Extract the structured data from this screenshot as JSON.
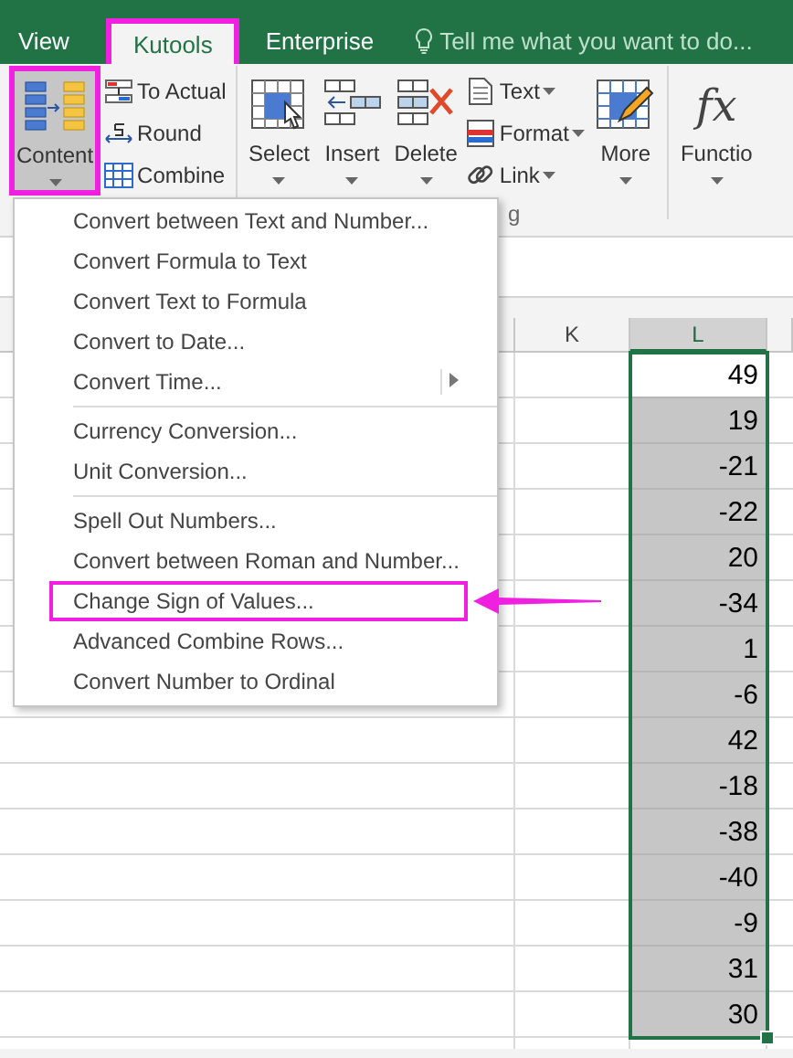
{
  "tabs": [
    {
      "label": "View",
      "selected": false
    },
    {
      "label": "Kutools",
      "selected": true
    },
    {
      "label": "Enterprise",
      "selected": false
    }
  ],
  "tell_me": {
    "placeholder": "Tell me what you want to do..."
  },
  "ribbon": {
    "controls": [
      {
        "kind": "large",
        "label": "Content",
        "highlighted": true
      },
      {
        "kind": "stack",
        "items": [
          {
            "label": "To Actual",
            "dropdown": false
          },
          {
            "label": "Round",
            "dropdown": false
          },
          {
            "label": "Combine",
            "dropdown": false
          }
        ]
      },
      {
        "kind": "separator"
      },
      {
        "kind": "large",
        "label": "Select",
        "highlighted": false
      },
      {
        "kind": "large",
        "label": "Insert",
        "highlighted": false
      },
      {
        "kind": "large",
        "label": "Delete",
        "highlighted": false
      },
      {
        "kind": "stack",
        "items": [
          {
            "label": "Text",
            "dropdown": true
          },
          {
            "label": "Format",
            "dropdown": true
          },
          {
            "label": "Link",
            "dropdown": true
          }
        ]
      },
      {
        "kind": "large",
        "label": "More",
        "highlighted": false
      },
      {
        "kind": "separator"
      },
      {
        "kind": "large",
        "label": "Functio",
        "glyph": "fx",
        "highlighted": false
      }
    ],
    "group_label": "g"
  },
  "menu": {
    "groups": [
      [
        {
          "label": "Convert between Text and Number...",
          "submenu": false,
          "highlighted": false
        },
        {
          "label": "Convert Formula to Text",
          "submenu": false,
          "highlighted": false
        },
        {
          "label": "Convert Text to Formula",
          "submenu": false,
          "highlighted": false
        },
        {
          "label": "Convert to Date...",
          "submenu": false,
          "highlighted": false
        },
        {
          "label": "Convert Time...",
          "submenu": true,
          "highlighted": false
        }
      ],
      [
        {
          "label": "Currency Conversion...",
          "submenu": false,
          "highlighted": false
        },
        {
          "label": "Unit Conversion...",
          "submenu": false,
          "highlighted": false
        }
      ],
      [
        {
          "label": "Spell Out Numbers...",
          "submenu": false,
          "highlighted": false
        },
        {
          "label": "Convert between Roman and Number...",
          "submenu": false,
          "highlighted": false
        },
        {
          "label": "Change Sign of Values...",
          "submenu": false,
          "highlighted": true
        },
        {
          "label": "Advanced Combine Rows...",
          "submenu": false,
          "highlighted": false
        },
        {
          "label": "Convert Number to Ordinal",
          "submenu": false,
          "highlighted": false
        }
      ]
    ]
  },
  "sheet": {
    "columns": [
      {
        "label": "K",
        "selected": false
      },
      {
        "label": "L",
        "selected": true
      }
    ],
    "cells": [
      {
        "value": "49",
        "active": true
      },
      {
        "value": "19",
        "active": false
      },
      {
        "value": "-21",
        "active": false
      },
      {
        "value": "-22",
        "active": false
      },
      {
        "value": "20",
        "active": false
      },
      {
        "value": "-34",
        "active": false
      },
      {
        "value": "1",
        "active": false
      },
      {
        "value": "-6",
        "active": false
      },
      {
        "value": "42",
        "active": false
      },
      {
        "value": "-18",
        "active": false
      },
      {
        "value": "-38",
        "active": false
      },
      {
        "value": "-40",
        "active": false
      },
      {
        "value": "-9",
        "active": false
      },
      {
        "value": "31",
        "active": false
      },
      {
        "value": "30",
        "active": false
      }
    ]
  }
}
